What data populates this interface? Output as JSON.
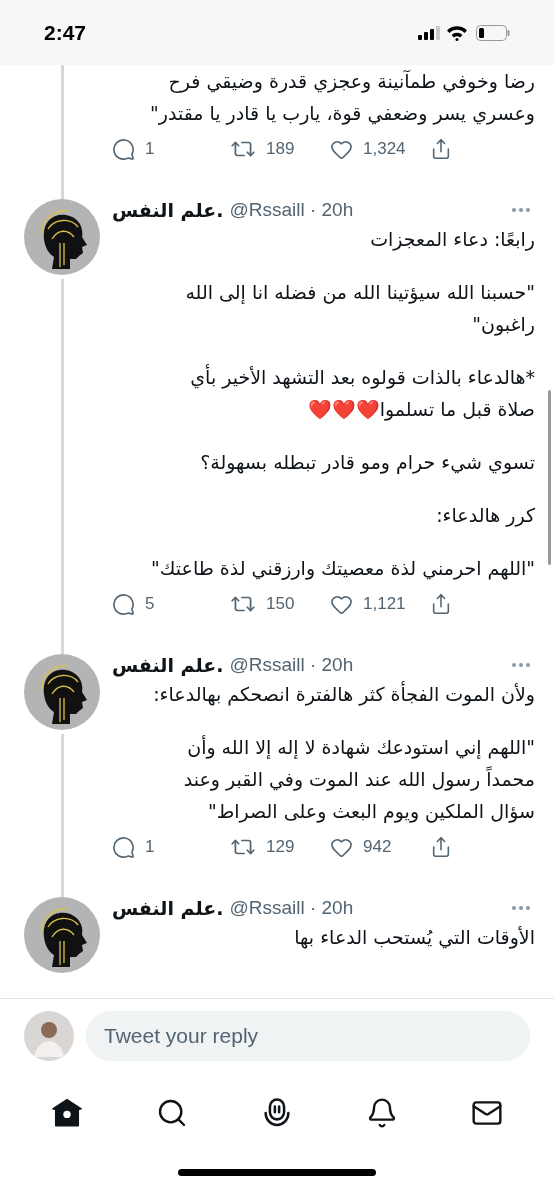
{
  "status_bar": {
    "time": "2:47"
  },
  "tweets": [
    {
      "continuation": true,
      "paragraphs": [
        "رضا وخوفي طمآنينة وعجزي قدرة وضيقي فرح\nوعسري يسر وضعفي قوة، يارب يا قادر يا مقتدر\""
      ],
      "actions": {
        "replies": "1",
        "retweets": "189",
        "likes": "1,324"
      }
    },
    {
      "continuation": false,
      "name": "علم النفس.",
      "handle": "@Rssaill · 20h",
      "paragraphs": [
        "رابعًا: دعاء المعجزات",
        "\"حسبنا الله سيؤتينا الله من فضله انا إلى الله\nراغبون\"",
        "*هالدعاء بالذات قولوه بعد التشهد الأخير بأي\nصلاة قبل ما تسلموا❤️❤️❤️",
        "تسوي شيء حرام ومو قادر تبطله بسهولة؟",
        "كرر هالدعاء:",
        "\"اللهم احرمني لذة معصيتك وارزقني لذة طاعتك\""
      ],
      "actions": {
        "replies": "5",
        "retweets": "150",
        "likes": "1,121"
      }
    },
    {
      "continuation": false,
      "name": "علم النفس.",
      "handle": "@Rssaill · 20h",
      "paragraphs": [
        "ولأن الموت الفجأة كثر هالفترة انصحكم بهالدعاء:",
        "\"اللهم إني استودعك شهادة لا إله إلا الله وأن\nمحمداً رسول الله عند الموت وفي القبر وعند\nسؤال الملكين ويوم البعث وعلى الصراط\""
      ],
      "actions": {
        "replies": "1",
        "retweets": "129",
        "likes": "942"
      }
    },
    {
      "continuation": false,
      "name": "علم النفس.",
      "handle": "@Rssaill · 20h",
      "paragraphs": [
        "الأوقات التي يُستحب الدعاء بها"
      ]
    }
  ],
  "reply": {
    "placeholder": "Tweet your reply"
  },
  "nav": [
    {
      "kind": "home",
      "selected": true
    },
    {
      "kind": "search",
      "selected": false
    },
    {
      "kind": "spaces",
      "selected": false
    },
    {
      "kind": "notifications",
      "selected": false
    },
    {
      "kind": "messages",
      "selected": false
    }
  ]
}
